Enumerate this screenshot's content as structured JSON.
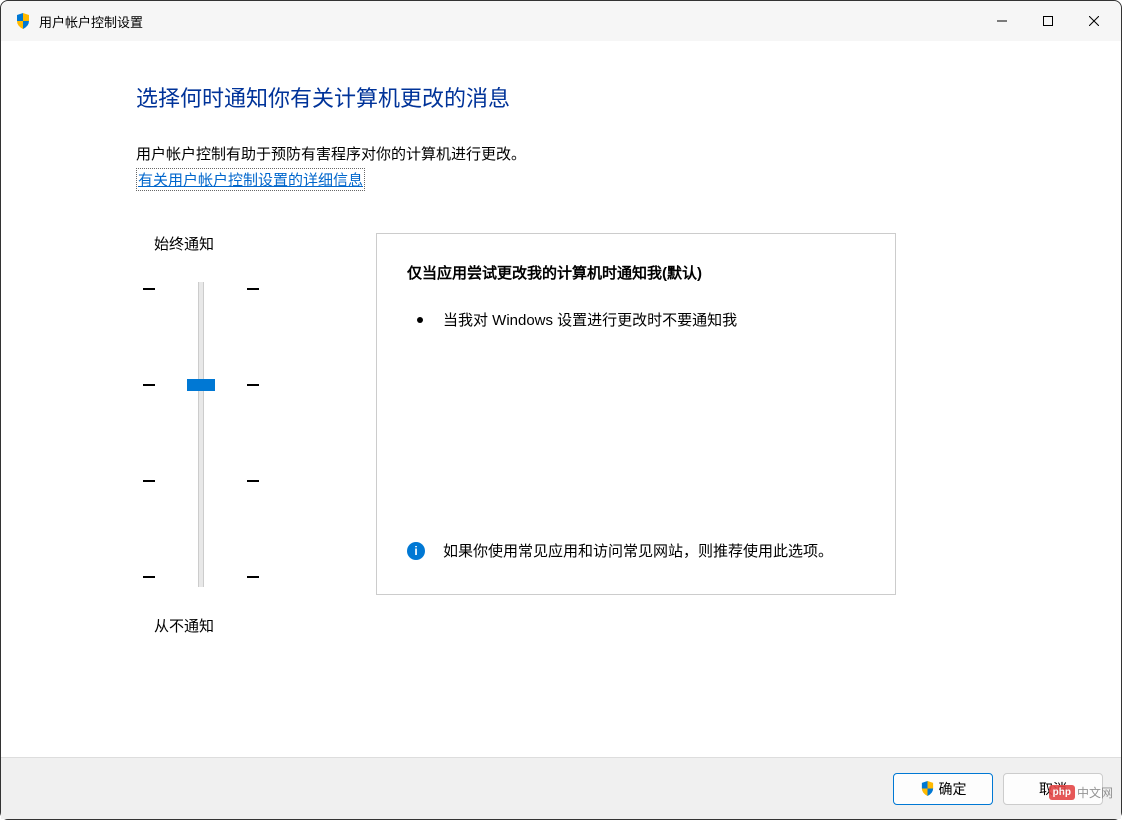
{
  "titlebar": {
    "title": "用户帐户控制设置"
  },
  "page": {
    "heading": "选择何时通知你有关计算机更改的消息",
    "description": "用户帐户控制有助于预防有害程序对你的计算机进行更改。",
    "link_text": "有关用户帐户控制设置的详细信息"
  },
  "slider": {
    "label_top": "始终通知",
    "label_bottom": "从不通知",
    "levels": 4,
    "current_level": 2
  },
  "info": {
    "heading": "仅当应用尝试更改我的计算机时通知我(默认)",
    "bullet": "当我对 Windows 设置进行更改时不要通知我",
    "recommendation": "如果你使用常见应用和访问常见网站，则推荐使用此选项。"
  },
  "footer": {
    "ok": "确定",
    "cancel": "取消"
  },
  "watermark": {
    "logo": "php",
    "text": "中文网"
  }
}
